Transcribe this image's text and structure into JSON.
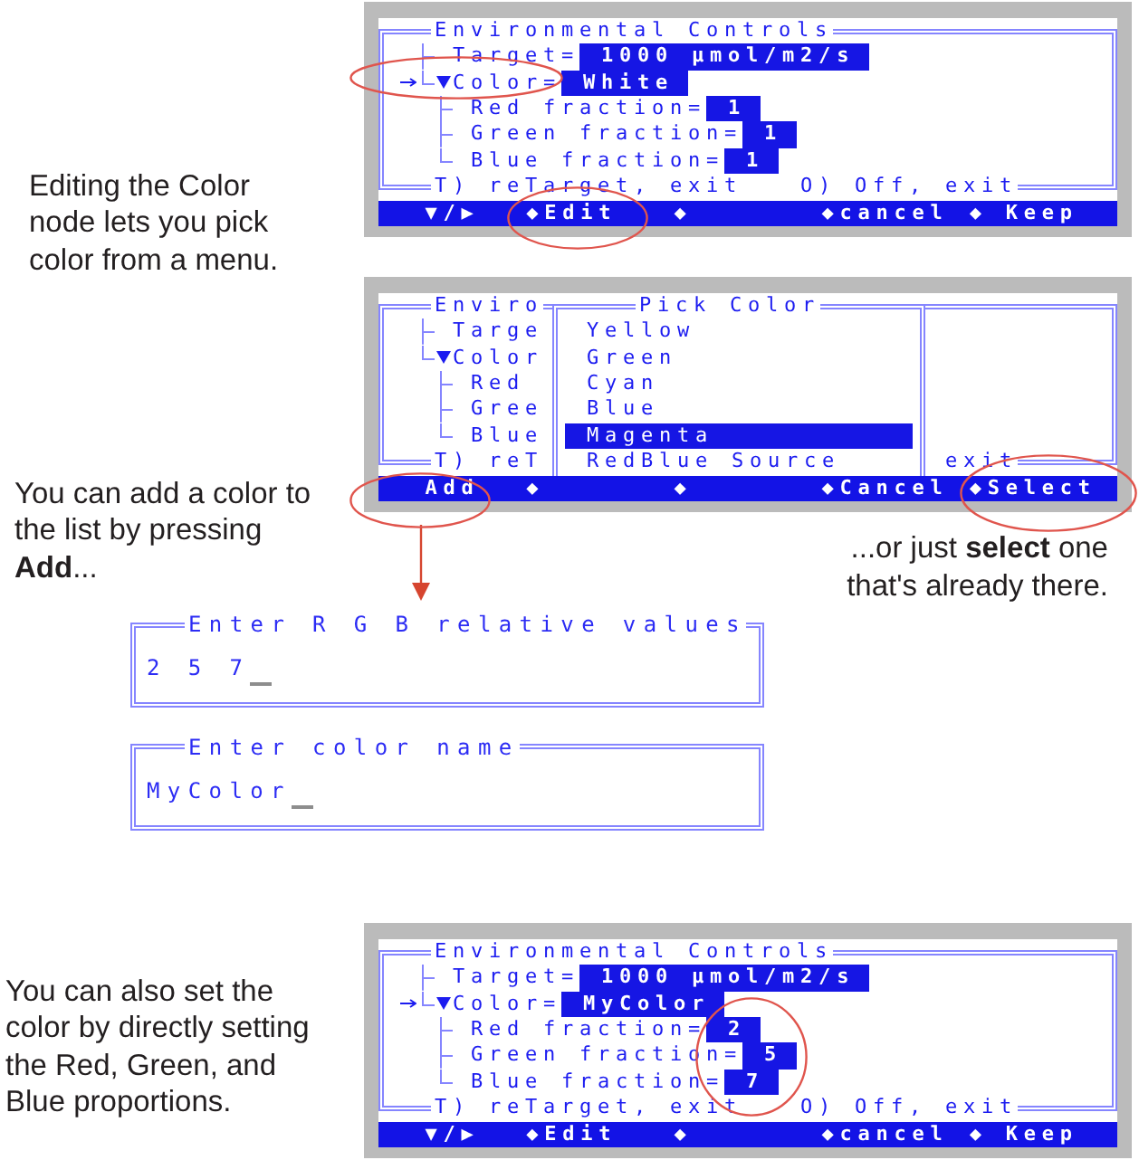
{
  "sections": [
    {
      "screen": {
        "window": {
          "title": "Environmental Controls",
          "tree": [
            {
              "label": "Target=",
              "value": "1000 μmol/m2/s",
              "selected": false
            },
            {
              "label": "Color=",
              "value": "White",
              "selected": true,
              "expanded": true,
              "children": [
                {
                  "label": "Red fraction=",
                  "value": "1",
                  "selected": false
                },
                {
                  "label": "Green fraction=",
                  "value": "1",
                  "selected": false
                },
                {
                  "label": "Blue fraction=",
                  "value": "1",
                  "selected": false
                }
              ]
            }
          ],
          "footer": [
            "T) reTarget, exit",
            "O) Off, exit"
          ]
        },
        "softkeys": [
          "▼/▶",
          "◆Edit",
          "◆",
          "◆cancel",
          "◆ Keep"
        ]
      },
      "caption": "Editing the Color node lets you pick color from a menu."
    },
    {
      "screen": {
        "window": {
          "title": "Enviro",
          "tree": [
            {
              "label": "Targe"
            },
            {
              "label": "Color",
              "expanded": true,
              "children": [
                {
                  "label": "Red"
                },
                {
                  "label": "Gree"
                },
                {
                  "label": "Blue"
                }
              ]
            }
          ],
          "footer": [
            "T) reT",
            "exit"
          ]
        },
        "menu": {
          "title": "Pick Color",
          "items": [
            {
              "label": "Yellow",
              "selected": false
            },
            {
              "label": "Green",
              "selected": false
            },
            {
              "label": "Cyan",
              "selected": false
            },
            {
              "label": "Blue",
              "selected": false
            },
            {
              "label": "Magenta",
              "selected": true
            },
            {
              "label": "RedBlue Source",
              "selected": false
            }
          ]
        },
        "softkeys": [
          "Add",
          "◆",
          "◆",
          "◆Cancel",
          "◆Select"
        ]
      },
      "caption": "You can add a color to the list by pressing **Add**...",
      "side_caption": "...or just **select** one that's already there.",
      "dialogs": [
        {
          "title": "Enter R G B relative values",
          "value": "2 5 7",
          "focused": true
        },
        {
          "title": "Enter color name",
          "value": "MyColor",
          "focused": true
        }
      ]
    },
    {
      "screen": {
        "window": {
          "title": "Environmental Controls",
          "tree": [
            {
              "label": "Target=",
              "value": "1000 μmol/m2/s",
              "selected": false
            },
            {
              "label": "Color=",
              "value": "MyColor",
              "selected": true,
              "expanded": true,
              "children": [
                {
                  "label": "Red fraction=",
                  "value": "2",
                  "selected": false
                },
                {
                  "label": "Green fraction=",
                  "value": "5",
                  "selected": false
                },
                {
                  "label": "Blue fraction=",
                  "value": "7",
                  "selected": false
                }
              ]
            }
          ],
          "footer": [
            "T) reTarget, exit",
            "O) Off, exit"
          ]
        },
        "softkeys": [
          "▼/▶",
          "◆Edit",
          "◆",
          "◆cancel",
          "◆ Keep"
        ]
      },
      "caption": "You can also set the color by directly setting the Red, Green, and Blue proportions."
    }
  ]
}
